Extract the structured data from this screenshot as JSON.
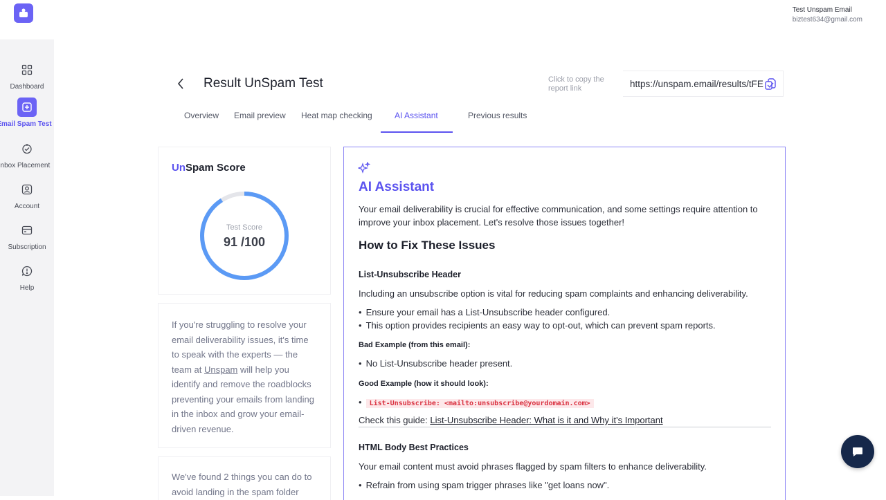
{
  "user": {
    "name": "Test Unspam Email",
    "email": "biztest634@gmail.com"
  },
  "sidebar": {
    "items": [
      {
        "label": "Dashboard",
        "icon": "grid-icon"
      },
      {
        "label": "Email Spam Test",
        "icon": "plus-square-icon",
        "active": true
      },
      {
        "label": "Inbox Placement",
        "icon": "inbox-icon"
      },
      {
        "label": "Account",
        "icon": "user-icon"
      },
      {
        "label": "Subscription",
        "icon": "card-icon"
      },
      {
        "label": "Help",
        "icon": "help-icon"
      }
    ]
  },
  "header": {
    "title": "Result UnSpam Test",
    "copy_hint": "Click to copy the report link",
    "report_link": "https://unspam.email/results/tFE"
  },
  "tabs": [
    {
      "label": "Overview"
    },
    {
      "label": "Email preview"
    },
    {
      "label": "Heat map checking"
    },
    {
      "label": "AI Assistant",
      "active": true
    },
    {
      "label": "Previous results"
    }
  ],
  "score": {
    "title_prefix": "Un",
    "title_rest": "Spam Score",
    "label": "Test Score",
    "value_text": "91 /100",
    "fraction": 0.91,
    "ring_color": "#5b9af5",
    "track_color": "#e4e5ea"
  },
  "expert": {
    "text_before": "If you're struggling to resolve your email deliverability issues, it's time to speak with the experts — the team at ",
    "link": "Unspam",
    "text_after": " will help you identify and remove the roadblocks preventing your emails from landing in the inbox and grow your email-driven revenue."
  },
  "found": {
    "text": "We've found 2 things you can do to avoid landing in the spam folder"
  },
  "ai": {
    "title": "AI Assistant",
    "intro": "Your email deliverability is crucial for effective communication, and some settings require attention to improve your inbox placement. Let's resolve those issues together!",
    "how_to_fix": "How to Fix These Issues",
    "section1": {
      "title": "List-Unsubscribe Header",
      "desc": "Including an unsubscribe option is vital for reducing spam complaints and enhancing deliverability.",
      "bullets": [
        "Ensure your email has a List-Unsubscribe header configured.",
        "This option provides recipients an easy way to opt-out, which can prevent spam reports."
      ],
      "bad_label": "Bad Example (from this email):",
      "bad_bullet": "No List-Unsubscribe header present.",
      "good_label": "Good Example (how it should look):",
      "good_code": "List-Unsubscribe: <mailto:unsubscribe@yourdomain.com>",
      "guide_prefix": "Check this guide: ",
      "guide_link": "List-Unsubscribe Header: What is it and Why it's Important"
    },
    "section2": {
      "title": "HTML Body Best Practices",
      "desc": "Your email content must avoid phrases flagged by spam filters to enhance deliverability.",
      "bullet": "Refrain from using spam trigger phrases like \"get loans now\"."
    }
  },
  "colors": {
    "accent": "#5b53ef",
    "brand": "#6b63f5",
    "chat": "#16284a"
  }
}
